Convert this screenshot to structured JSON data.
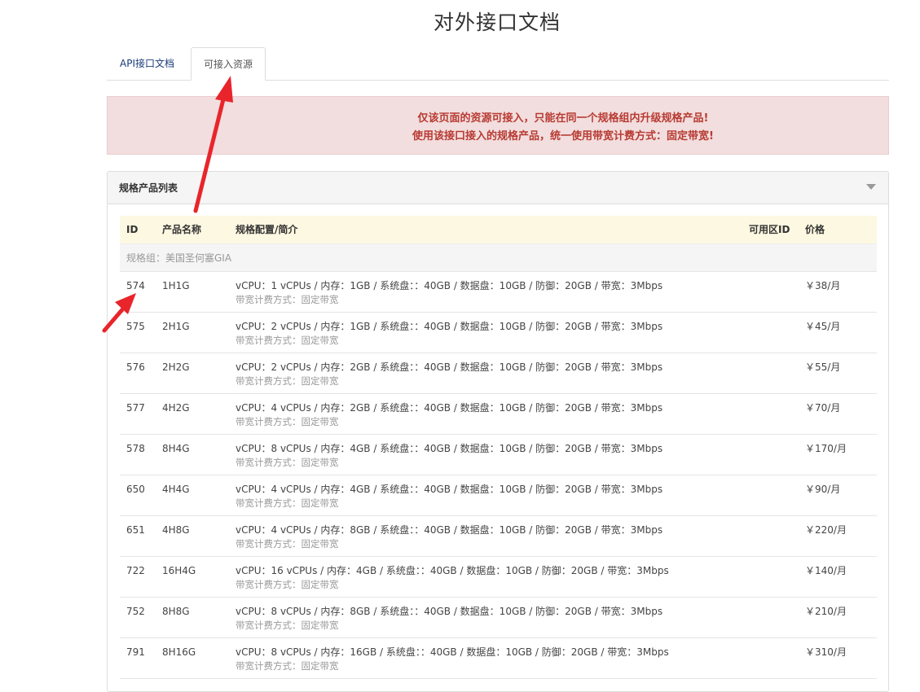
{
  "page_title": "对外接口文档",
  "tabs": [
    {
      "label": "API接口文档",
      "active": false
    },
    {
      "label": "可接入资源",
      "active": true
    }
  ],
  "alert": {
    "line1": "仅该页面的资源可接入，只能在同一个规格组内升级规格产品!",
    "line2": "使用该接口接入的规格产品，统一使用带宽计费方式：固定带宽!"
  },
  "panel": {
    "title": "规格产品列表",
    "toggle_icon": "caret-down-icon"
  },
  "table": {
    "headers": [
      "ID",
      "产品名称",
      "规格配置/简介",
      "可用区ID",
      "价格"
    ],
    "group_label": "规格组：美国圣何塞GIA",
    "rows": [
      {
        "id": "574",
        "name": "1H1G",
        "spec": "vCPU：1 vCPUs / 内存：1GB / 系统盘：：40GB / 数据盘：10GB / 防御：20GB / 带宽：3Mbps",
        "billing": "带宽计费方式：固定带宽",
        "zone": "",
        "price": "￥38/月"
      },
      {
        "id": "575",
        "name": "2H1G",
        "spec": "vCPU：2 vCPUs / 内存：1GB / 系统盘：：40GB / 数据盘：10GB / 防御：20GB / 带宽：3Mbps",
        "billing": "带宽计费方式：固定带宽",
        "zone": "",
        "price": "￥45/月"
      },
      {
        "id": "576",
        "name": "2H2G",
        "spec": "vCPU：2 vCPUs / 内存：2GB / 系统盘：：40GB / 数据盘：10GB / 防御：20GB / 带宽：3Mbps",
        "billing": "带宽计费方式：固定带宽",
        "zone": "",
        "price": "￥55/月"
      },
      {
        "id": "577",
        "name": "4H2G",
        "spec": "vCPU：4 vCPUs / 内存：2GB / 系统盘：：40GB / 数据盘：10GB / 防御：20GB / 带宽：3Mbps",
        "billing": "带宽计费方式：固定带宽",
        "zone": "",
        "price": "￥70/月"
      },
      {
        "id": "578",
        "name": "8H4G",
        "spec": "vCPU：8 vCPUs / 内存：4GB / 系统盘：：40GB / 数据盘：10GB / 防御：20GB / 带宽：3Mbps",
        "billing": "带宽计费方式：固定带宽",
        "zone": "",
        "price": "￥170/月"
      },
      {
        "id": "650",
        "name": "4H4G",
        "spec": "vCPU：4 vCPUs / 内存：4GB / 系统盘：：40GB / 数据盘：10GB / 防御：20GB / 带宽：3Mbps",
        "billing": "带宽计费方式：固定带宽",
        "zone": "",
        "price": "￥90/月"
      },
      {
        "id": "651",
        "name": "4H8G",
        "spec": "vCPU：4 vCPUs / 内存：8GB / 系统盘：：40GB / 数据盘：10GB / 防御：20GB / 带宽：3Mbps",
        "billing": "带宽计费方式：固定带宽",
        "zone": "",
        "price": "￥220/月"
      },
      {
        "id": "722",
        "name": "16H4G",
        "spec": "vCPU：16 vCPUs / 内存：4GB / 系统盘：：40GB / 数据盘：10GB / 防御：20GB / 带宽：3Mbps",
        "billing": "带宽计费方式：固定带宽",
        "zone": "",
        "price": "￥140/月"
      },
      {
        "id": "752",
        "name": "8H8G",
        "spec": "vCPU：8 vCPUs / 内存：8GB / 系统盘：：40GB / 数据盘：10GB / 防御：20GB / 带宽：3Mbps",
        "billing": "带宽计费方式：固定带宽",
        "zone": "",
        "price": "￥210/月"
      },
      {
        "id": "791",
        "name": "8H16G",
        "spec": "vCPU：8 vCPUs / 内存：16GB / 系统盘：：40GB / 数据盘：10GB / 防御：20GB / 带宽：3Mbps",
        "billing": "带宽计费方式：固定带宽",
        "zone": "",
        "price": "￥310/月"
      }
    ]
  },
  "annotations": {
    "arrow_color": "#e8252b",
    "arrow_icons": [
      "red-arrow-icon-tab",
      "red-arrow-icon-id"
    ]
  }
}
